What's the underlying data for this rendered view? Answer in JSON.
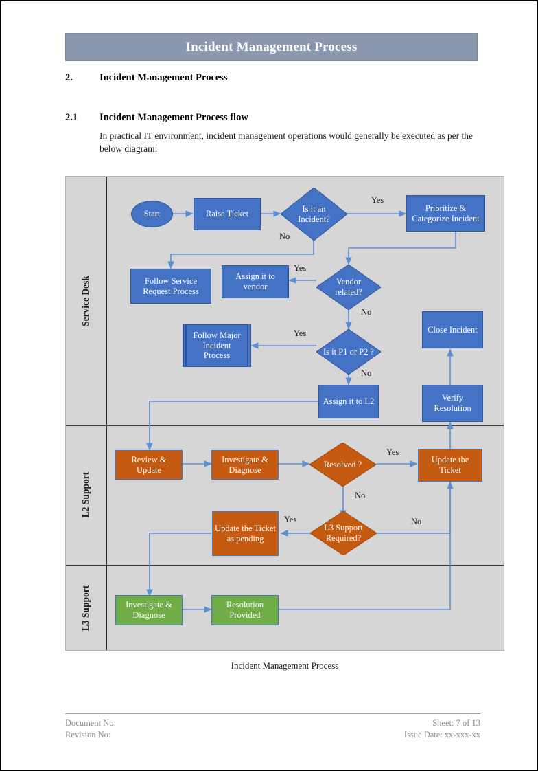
{
  "document": {
    "banner_title": "Incident Management Process",
    "section_2": {
      "number": "2.",
      "title": "Incident Management Process"
    },
    "section_2_1": {
      "number": "2.1",
      "title": "Incident Management Process flow"
    },
    "intro_paragraph": "In practical IT environment, incident management operations would generally be executed as per the below diagram:",
    "figure_caption": "Incident Management Process"
  },
  "footer": {
    "document_no": "Document No:",
    "revision_no": "Revision No:",
    "sheet": "Sheet: 7 of 13",
    "issue_date": "Issue Date: xx-xxx-xx"
  },
  "colors": {
    "banner": "#8B97AD",
    "diagram_background": "#D6D6D6",
    "service_desk_node": "#4472C4",
    "l2_support_node": "#C55A11",
    "l3_support_node": "#70AD47",
    "connector": "#5B8FD1",
    "lane_divider": "#3A3A3A"
  },
  "diagram": {
    "title": "Incident Management Process",
    "lanes": [
      {
        "id": "service-desk",
        "label": "Service Desk"
      },
      {
        "id": "l2-support",
        "label": "L2 Support"
      },
      {
        "id": "l3-support",
        "label": "L3 Support"
      }
    ],
    "nodes": [
      {
        "id": "start",
        "lane": "service-desk",
        "shape": "oval",
        "color": "blue",
        "label": "Start"
      },
      {
        "id": "raise-ticket",
        "lane": "service-desk",
        "shape": "process",
        "color": "blue",
        "label": "Raise Ticket"
      },
      {
        "id": "is-it-an-incident",
        "lane": "service-desk",
        "shape": "decision",
        "color": "blue",
        "label": "Is it an Incident?"
      },
      {
        "id": "prioritize",
        "lane": "service-desk",
        "shape": "process",
        "color": "blue",
        "label": "Prioritize & Categorize Incident"
      },
      {
        "id": "follow-service-req",
        "lane": "service-desk",
        "shape": "process",
        "color": "blue",
        "label": "Follow Service Request Process"
      },
      {
        "id": "assign-to-vendor",
        "lane": "service-desk",
        "shape": "process",
        "color": "blue",
        "label": "Assign it to vendor"
      },
      {
        "id": "vendor-related",
        "lane": "service-desk",
        "shape": "decision",
        "color": "blue",
        "label": "Vendor related?"
      },
      {
        "id": "follow-major",
        "lane": "service-desk",
        "shape": "predefined",
        "color": "blue",
        "label": "Follow Major Incident Process"
      },
      {
        "id": "is-it-p1-p2",
        "lane": "service-desk",
        "shape": "decision",
        "color": "blue",
        "label": "Is it P1 or P2 ?"
      },
      {
        "id": "close-incident",
        "lane": "service-desk",
        "shape": "process",
        "color": "blue",
        "label": "Close Incident"
      },
      {
        "id": "assign-to-l2",
        "lane": "service-desk",
        "shape": "process",
        "color": "blue",
        "label": "Assign it to L2"
      },
      {
        "id": "verify-resolution",
        "lane": "service-desk",
        "shape": "process",
        "color": "blue",
        "label": "Verify Resolution"
      },
      {
        "id": "review-update",
        "lane": "l2-support",
        "shape": "process",
        "color": "orange",
        "label": "Review & Update"
      },
      {
        "id": "investigate-l2",
        "lane": "l2-support",
        "shape": "process",
        "color": "orange",
        "label": "Investigate & Diagnose"
      },
      {
        "id": "resolved",
        "lane": "l2-support",
        "shape": "decision",
        "color": "orange",
        "label": "Resolved ?"
      },
      {
        "id": "update-ticket",
        "lane": "l2-support",
        "shape": "process",
        "color": "orange",
        "label": "Update the Ticket"
      },
      {
        "id": "update-pending",
        "lane": "l2-support",
        "shape": "process",
        "color": "orange",
        "label": "Update the Ticket as pending"
      },
      {
        "id": "l3-required",
        "lane": "l2-support",
        "shape": "decision",
        "color": "orange",
        "label": "L3 Support Required?"
      },
      {
        "id": "investigate-l3",
        "lane": "l3-support",
        "shape": "process",
        "color": "green",
        "label": "Investigate & Diagnose"
      },
      {
        "id": "resolution-provided",
        "lane": "l3-support",
        "shape": "process",
        "color": "green",
        "label": "Resolution Provided"
      }
    ],
    "edge_labels": [
      {
        "id": "incident-yes",
        "from": "is-it-an-incident",
        "to": "prioritize",
        "label": "Yes"
      },
      {
        "id": "incident-no",
        "from": "is-it-an-incident",
        "to": "follow-service-req",
        "label": "No"
      },
      {
        "id": "vendor-yes",
        "from": "vendor-related",
        "to": "assign-to-vendor",
        "label": "Yes"
      },
      {
        "id": "vendor-no",
        "from": "vendor-related",
        "to": "is-it-p1-p2",
        "label": "No"
      },
      {
        "id": "p1p2-yes",
        "from": "is-it-p1-p2",
        "to": "follow-major",
        "label": "Yes"
      },
      {
        "id": "p1p2-no",
        "from": "is-it-p1-p2",
        "to": "assign-to-l2",
        "label": "No"
      },
      {
        "id": "resolved-yes",
        "from": "resolved",
        "to": "update-ticket",
        "label": "Yes"
      },
      {
        "id": "resolved-no",
        "from": "resolved",
        "to": "l3-required",
        "label": "No"
      },
      {
        "id": "l3-yes",
        "from": "l3-required",
        "to": "update-pending",
        "label": "Yes"
      },
      {
        "id": "l3-no",
        "from": "l3-required",
        "to": "update-ticket",
        "label": "No"
      }
    ]
  }
}
